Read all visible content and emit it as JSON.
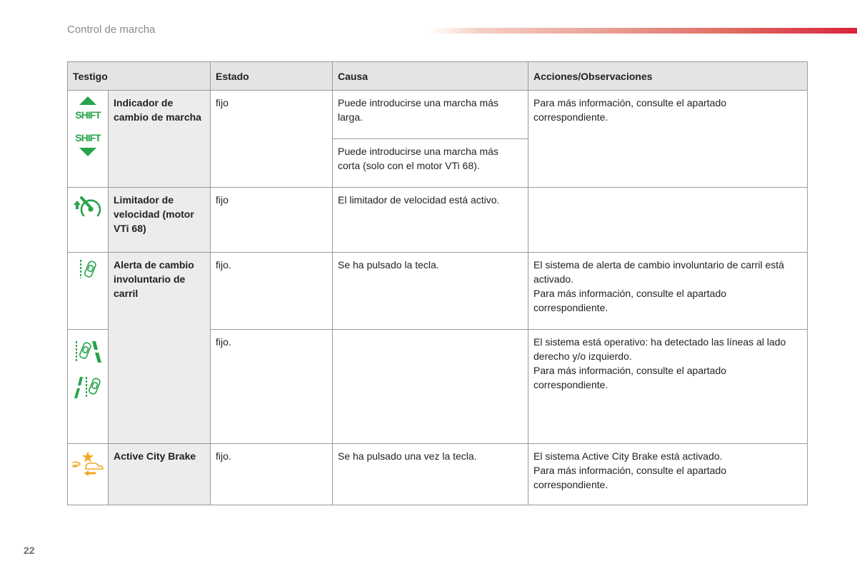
{
  "header": {
    "section_title": "Control de marcha",
    "accent_color": "#d9233a"
  },
  "footer": {
    "page_number": "22"
  },
  "table": {
    "columns": [
      "Testigo",
      "Estado",
      "Causa",
      "Acciones/Observaciones"
    ],
    "rows": [
      {
        "name": "Indicador de cambio de marcha",
        "icon": "shift-up-down-icon",
        "icon_color": "#27a44a",
        "icon_labels": [
          "SHIFT",
          "SHIFT"
        ],
        "estado": "fijo",
        "causas": [
          "Puede introducirse una marcha más larga.",
          "Puede introducirse una marcha más corta (solo con el motor VTi 68)."
        ],
        "acciones": "Para más información, consulte el apartado correspondiente."
      },
      {
        "name": "Limitador de velocidad (motor VTi 68)",
        "icon": "speed-limiter-icon",
        "icon_color": "#27a44a",
        "estado": "fijo",
        "causa": "El limitador de velocidad está activo.",
        "acciones": ""
      },
      {
        "name": "Alerta de cambio involuntario de carril",
        "icon": "lane-departure-icon",
        "icon_color": "#27a44a",
        "sub": [
          {
            "estado": "fijo.",
            "causa": "Se ha pulsado la tecla.",
            "acciones": "El sistema de alerta de cambio involuntario de carril está activado.\nPara más información, consulte el apartado correspondiente."
          },
          {
            "icons": [
              "lane-detected-right-icon",
              "lane-detected-left-icon"
            ],
            "estado": "fijo.",
            "causa": "",
            "acciones": "El sistema está operativo: ha detectado las líneas al lado derecho y/o izquierdo.\nPara más información, consulte el apartado correspondiente."
          }
        ]
      },
      {
        "name": "Active City Brake",
        "icon": "active-city-brake-icon",
        "icon_color": "#f2a81d",
        "estado": "fijo.",
        "causa": "Se ha pulsado una vez la tecla.",
        "acciones": "El sistema Active City Brake está activado.\nPara más información, consulte el apartado correspondiente."
      }
    ]
  }
}
